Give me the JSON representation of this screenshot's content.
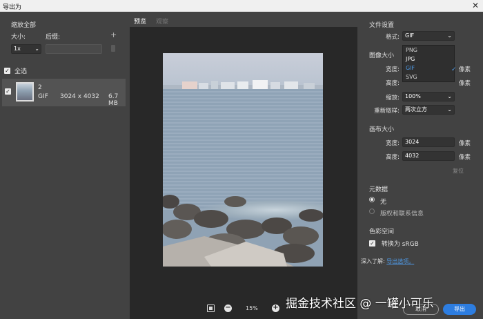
{
  "window": {
    "title": "导出为",
    "close_glyph": "✕"
  },
  "left": {
    "header": "缩放全部",
    "size_label": "大小:",
    "suffix_label": "后缀:",
    "add_glyph": "+",
    "scale_value": "1x",
    "select_all_label": "全选",
    "file": {
      "name": "2",
      "type": "GIF",
      "dimensions": "3024 x 4032",
      "size": "6.7 MB"
    }
  },
  "center": {
    "tab_preview": "预览",
    "tab_compare": "观察",
    "zoom": "15%"
  },
  "right": {
    "file_settings": "文件设置",
    "format_label": "格式:",
    "format_value": "GIF",
    "format_options": [
      "PNG",
      "JPG",
      "GIF",
      "SVG"
    ],
    "image_size": "图像大小",
    "width_label": "宽度:",
    "height_label": "高度:",
    "scale_label": "缩放:",
    "scale_value": "100%",
    "resample_label": "重新取样:",
    "resample_value": "两次立方",
    "unit": "像素",
    "canvas_size": "画布大小",
    "canvas_width_label": "宽度:",
    "canvas_width": "3024",
    "canvas_height_label": "高度:",
    "canvas_height": "4032",
    "reset": "复位",
    "metadata": "元数据",
    "meta_none": "无",
    "meta_copyright": "版权和联系信息",
    "color_space": "色彩空间",
    "convert_srgb": "转换为 sRGB",
    "learn_more": "深入了解:",
    "export_options": "导出选项。",
    "cancel": "取消",
    "export": "导出"
  },
  "watermark": "掘金技术社区 @ 一罐小可乐"
}
